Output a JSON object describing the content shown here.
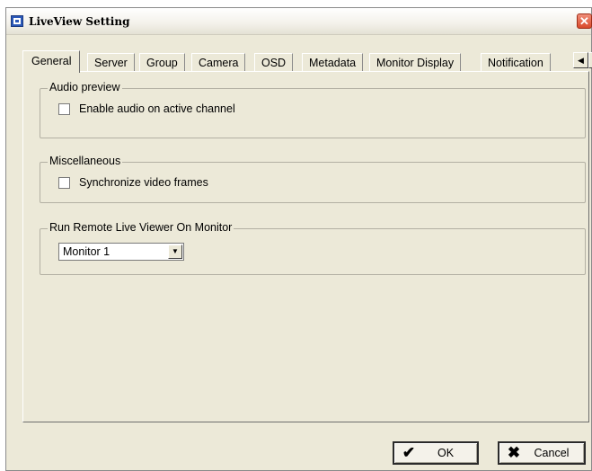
{
  "window": {
    "title": "LiveView Setting",
    "close_glyph": "✕"
  },
  "tabs": [
    {
      "label": "General",
      "active": true
    },
    {
      "label": "Server"
    },
    {
      "label": "Group"
    },
    {
      "label": "Camera"
    },
    {
      "label": "OSD"
    },
    {
      "label": "Metadata"
    },
    {
      "label": "Monitor Display"
    },
    {
      "label": "Notification"
    }
  ],
  "tab_scroll": {
    "left_glyph": "◀",
    "right_glyph": "▶"
  },
  "groups": {
    "audio": {
      "title": "Audio preview",
      "checkbox_label": "Enable audio on active channel",
      "checked": false
    },
    "misc": {
      "title": "Miscellaneous",
      "checkbox_label": "Synchronize video frames",
      "checked": false
    },
    "remote": {
      "title": "Run Remote Live Viewer On Monitor",
      "selected": "Monitor 1",
      "dropdown_glyph": "▼"
    }
  },
  "buttons": {
    "ok_label": "OK",
    "ok_icon": "✔",
    "cancel_label": "Cancel",
    "cancel_icon": "✖"
  },
  "colors": {
    "dialog_bg": "#ece9d8",
    "close_button": "#d94a2c"
  }
}
